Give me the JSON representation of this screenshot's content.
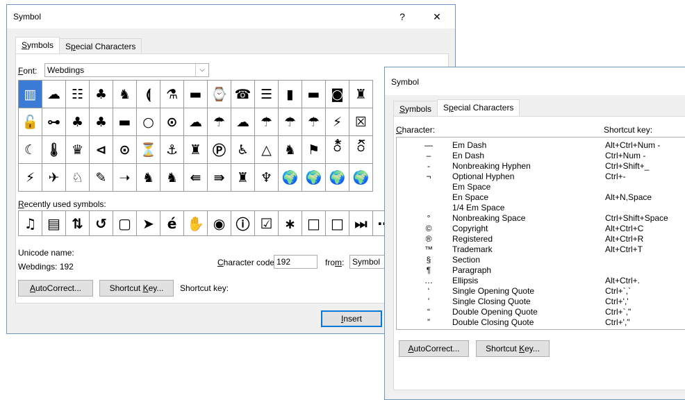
{
  "dialog1": {
    "title": "Symbol",
    "help": "?",
    "close": "✕",
    "tabs": [
      {
        "pre": "",
        "u": "S",
        "post": "ymbols"
      },
      {
        "pre": "S",
        "u": "p",
        "post": "ecial Characters"
      }
    ],
    "font_label": {
      "u": "F",
      "post": "ont:"
    },
    "font_value": "Webdings",
    "grid_symbols": [
      "▥",
      "☁",
      "☷",
      "♣",
      "♞",
      "⟬",
      "⚗",
      "▬",
      "⌚",
      "☎",
      "☰",
      "▮",
      "▬",
      "◙",
      "♜",
      "🔓",
      "⊶",
      "♣",
      "♣",
      "▬",
      "○",
      "⊙",
      "☁",
      "☂",
      "☁",
      "☂",
      "☂",
      "☂",
      "⚡",
      "☒",
      "☾",
      "🌡",
      "♛",
      "⊲",
      "⊙",
      "⏳",
      "⚓",
      "♜",
      "Ⓟ",
      "♿",
      "△",
      "♞",
      "⚑",
      "᭰",
      "᭱",
      "⚡",
      "✈",
      "♘",
      "✎",
      "➝",
      "♞",
      "♞",
      "⇚",
      "⇛",
      "♜",
      "♆",
      "🌍",
      "🌍",
      "🌍",
      "🌍"
    ],
    "recent_label": {
      "u": "R",
      "post": "ecently used symbols:"
    },
    "recent_symbols": [
      "♫",
      "▤",
      "⇅",
      "↺",
      "▢",
      "➤",
      "é",
      "✋",
      "◉",
      "ⓘ",
      "☑",
      "∗",
      "□",
      "□",
      "⏭",
      "⋯"
    ],
    "unicode_name_label": "Unicode name:",
    "unicode_value": "Webdings: 192",
    "char_code_label": {
      "u": "C",
      "post": "haracter code:"
    },
    "char_code_value": "192",
    "from_label": {
      "pre": "fro",
      "u": "m",
      "post": ":"
    },
    "from_value": "Symbol",
    "autocorrect": {
      "u": "A",
      "post": "utoCorrect..."
    },
    "shortcut_key_btn": {
      "pre": "Shortcut ",
      "u": "K",
      "post": "ey..."
    },
    "shortcut_key_label": "Shortcut key:",
    "insert": {
      "u": "I",
      "post": "nsert"
    }
  },
  "dialog2": {
    "title": "Symbol",
    "tabs": [
      {
        "pre": "",
        "u": "S",
        "post": "ymbols"
      },
      {
        "pre": "S",
        "u": "p",
        "post": "ecial Characters"
      }
    ],
    "col_character": {
      "u": "C",
      "post": "haracter:"
    },
    "col_shortcut": "Shortcut key:",
    "rows": [
      {
        "char": "—",
        "name": "Em Dash",
        "key": "Alt+Ctrl+Num -"
      },
      {
        "char": "–",
        "name": "En Dash",
        "key": "Ctrl+Num -"
      },
      {
        "char": "-",
        "name": "Nonbreaking Hyphen",
        "key": "Ctrl+Shift+_"
      },
      {
        "char": "¬",
        "name": "Optional Hyphen",
        "key": "Ctrl+-"
      },
      {
        "char": "",
        "name": "Em Space",
        "key": ""
      },
      {
        "char": "",
        "name": "En Space",
        "key": "Alt+N,Space"
      },
      {
        "char": "",
        "name": "1/4 Em Space",
        "key": ""
      },
      {
        "char": "°",
        "name": "Nonbreaking Space",
        "key": "Ctrl+Shift+Space"
      },
      {
        "char": "©",
        "name": "Copyright",
        "key": "Alt+Ctrl+C"
      },
      {
        "char": "®",
        "name": "Registered",
        "key": "Alt+Ctrl+R"
      },
      {
        "char": "™",
        "name": "Trademark",
        "key": "Alt+Ctrl+T"
      },
      {
        "char": "§",
        "name": "Section",
        "key": ""
      },
      {
        "char": "¶",
        "name": "Paragraph",
        "key": ""
      },
      {
        "char": "…",
        "name": "Ellipsis",
        "key": "Alt+Ctrl+."
      },
      {
        "char": "‘",
        "name": "Single Opening Quote",
        "key": "Ctrl+`,`"
      },
      {
        "char": "’",
        "name": "Single Closing Quote",
        "key": "Ctrl+','"
      },
      {
        "char": "“",
        "name": "Double Opening Quote",
        "key": "Ctrl+`,\""
      },
      {
        "char": "”",
        "name": "Double Closing Quote",
        "key": "Ctrl+',\""
      }
    ],
    "autocorrect": {
      "u": "A",
      "post": "utoCorrect..."
    },
    "shortcut_key_btn": {
      "pre": "Shortcut ",
      "u": "K",
      "post": "ey..."
    }
  }
}
